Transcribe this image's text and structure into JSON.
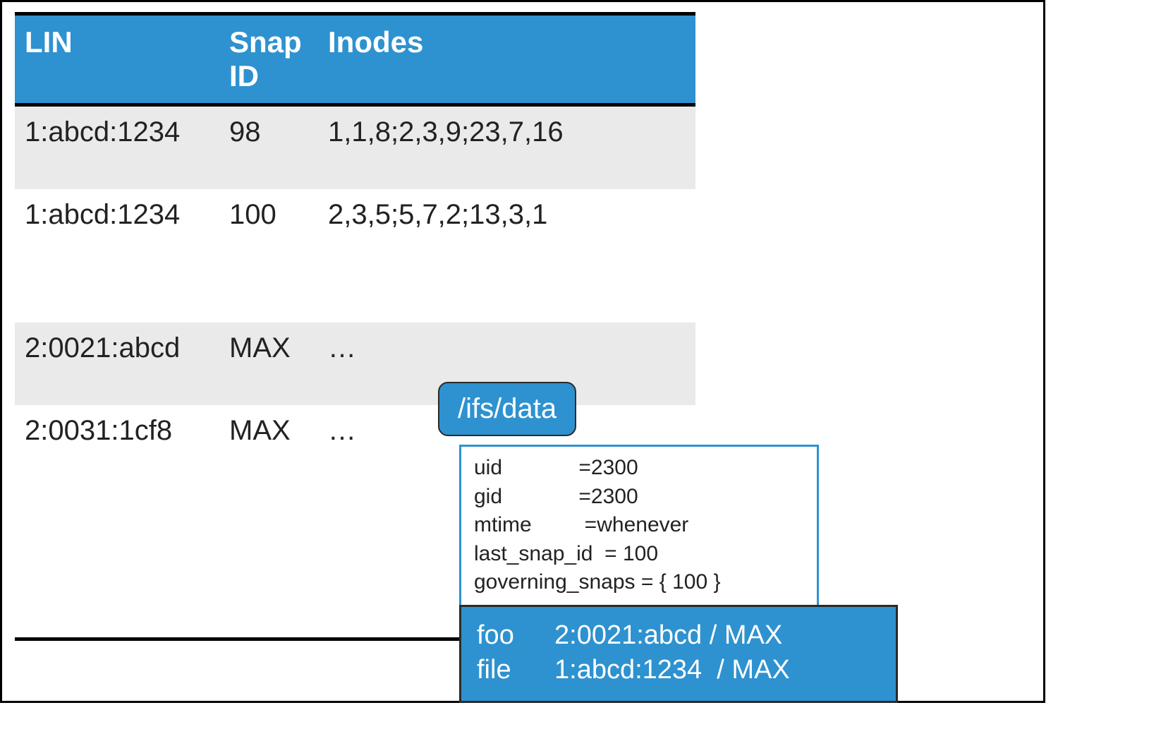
{
  "table": {
    "headers": {
      "lin": "LIN",
      "snap_id": "Snap ID",
      "inodes": "Inodes"
    },
    "rows": [
      {
        "lin": "1:abcd:1234",
        "snap_id": "98",
        "inodes": "1,1,8;2,3,9;23,7,16",
        "shaded": true
      },
      {
        "lin": "1:abcd:1234",
        "snap_id": "100",
        "inodes": "2,3,5;5,7,2;13,3,1",
        "shaded": false
      },
      {
        "lin": "2:0021:abcd",
        "snap_id": "MAX",
        "inodes": "…",
        "shaded": true
      },
      {
        "lin": "2:0031:1cf8",
        "snap_id": "MAX",
        "inodes": "…",
        "shaded": false
      }
    ]
  },
  "callout": {
    "path": "/ifs/data",
    "metadata": [
      {
        "key": "uid",
        "sep": "             =",
        "value": "2300"
      },
      {
        "key": "gid",
        "sep": "             =",
        "value": "2300"
      },
      {
        "key": "mtime",
        "sep": "         =",
        "value": "whenever"
      },
      {
        "key": "last_snap_id",
        "sep": "  = ",
        "value": "100"
      },
      {
        "key": "governing_snaps",
        "sep": " = ",
        "value": "{ 100 }"
      }
    ],
    "files": [
      {
        "name": "foo",
        "value": "2:0021:abcd / MAX"
      },
      {
        "name": "file",
        "value": "1:abcd:1234  / MAX"
      }
    ]
  }
}
